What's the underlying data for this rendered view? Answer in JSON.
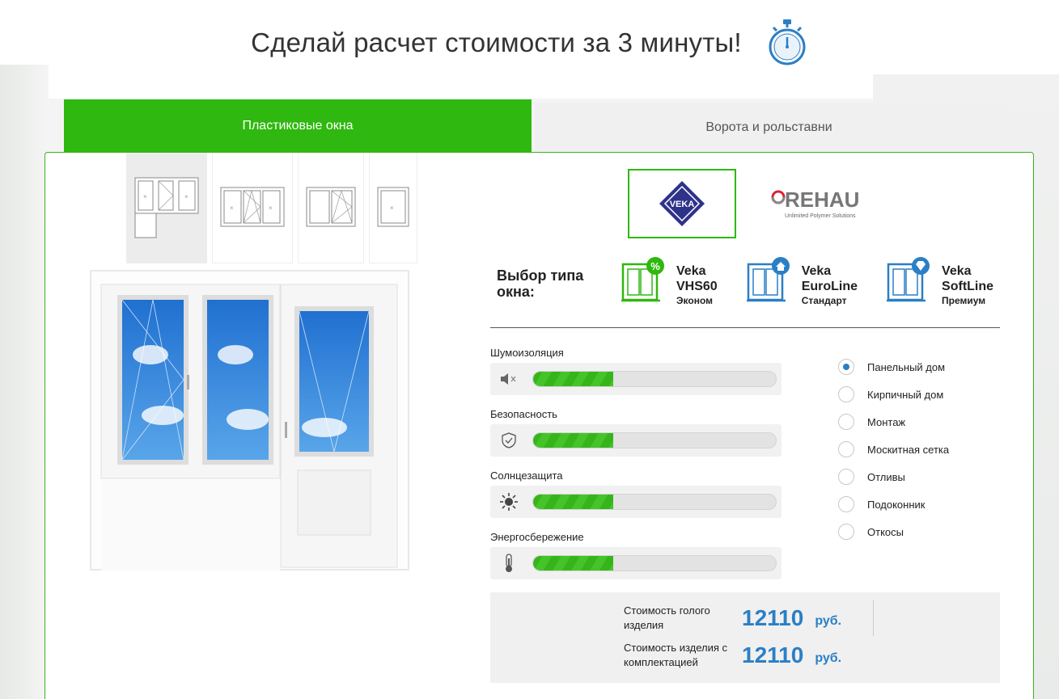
{
  "header": {
    "title": "Сделай расчет стоимости за 3 минуты!",
    "icon": "stopwatch-icon"
  },
  "tabs": [
    {
      "label": "Пластиковые окна",
      "active": true
    },
    {
      "label": "Ворота и рольставни",
      "active": false
    }
  ],
  "window_configs": [
    {
      "name": "balcony-block",
      "selected": true
    },
    {
      "name": "three-sash",
      "selected": false
    },
    {
      "name": "two-sash",
      "selected": false
    },
    {
      "name": "single-sash",
      "selected": false
    }
  ],
  "brands": [
    {
      "name": "VEKA",
      "selected": true
    },
    {
      "name": "REHAU",
      "subtitle": "Unlimited Polymer Solutions",
      "selected": false
    }
  ],
  "window_type": {
    "label": "Выбор типа окна:",
    "options": [
      {
        "name": "Veka VHS60",
        "line1": "Veka",
        "line2": "VHS60",
        "tier": "Эконом",
        "badge": "%",
        "color": "#2fb80f"
      },
      {
        "name": "Veka EuroLine",
        "line1": "Veka",
        "line2": "EuroLine",
        "tier": "Стандарт",
        "badge": "home",
        "color": "#2b7fc5"
      },
      {
        "name": "Veka SoftLine",
        "line1": "Veka",
        "line2": "SoftLine",
        "tier": "Премиум",
        "badge": "diamond",
        "color": "#2b7fc5"
      }
    ]
  },
  "metrics": [
    {
      "label": "Шумоизоляция",
      "icon": "speaker-mute-icon",
      "level": 0.33
    },
    {
      "label": "Безопасность",
      "icon": "shield-check-icon",
      "level": 0.33
    },
    {
      "label": "Солнцезащита",
      "icon": "sun-icon",
      "level": 0.33
    },
    {
      "label": "Энергосбережение",
      "icon": "thermometer-icon",
      "level": 0.33
    }
  ],
  "options": [
    {
      "label": "Панельный дом",
      "checked": true
    },
    {
      "label": "Кирпичный дом",
      "checked": false
    },
    {
      "label": "Монтаж",
      "checked": false
    },
    {
      "label": "Москитная сетка",
      "checked": false
    },
    {
      "label": "Отливы",
      "checked": false
    },
    {
      "label": "Подоконник",
      "checked": false
    },
    {
      "label": "Откосы",
      "checked": false
    }
  ],
  "price": {
    "bare_label": "Стоимость голого изделия",
    "bare_value": "12110",
    "full_label": "Стоимость изделия с комплектацией",
    "full_value": "12110",
    "currency": "руб."
  },
  "colors": {
    "accent_green": "#2fb80f",
    "price_blue": "#2b7fc5"
  }
}
